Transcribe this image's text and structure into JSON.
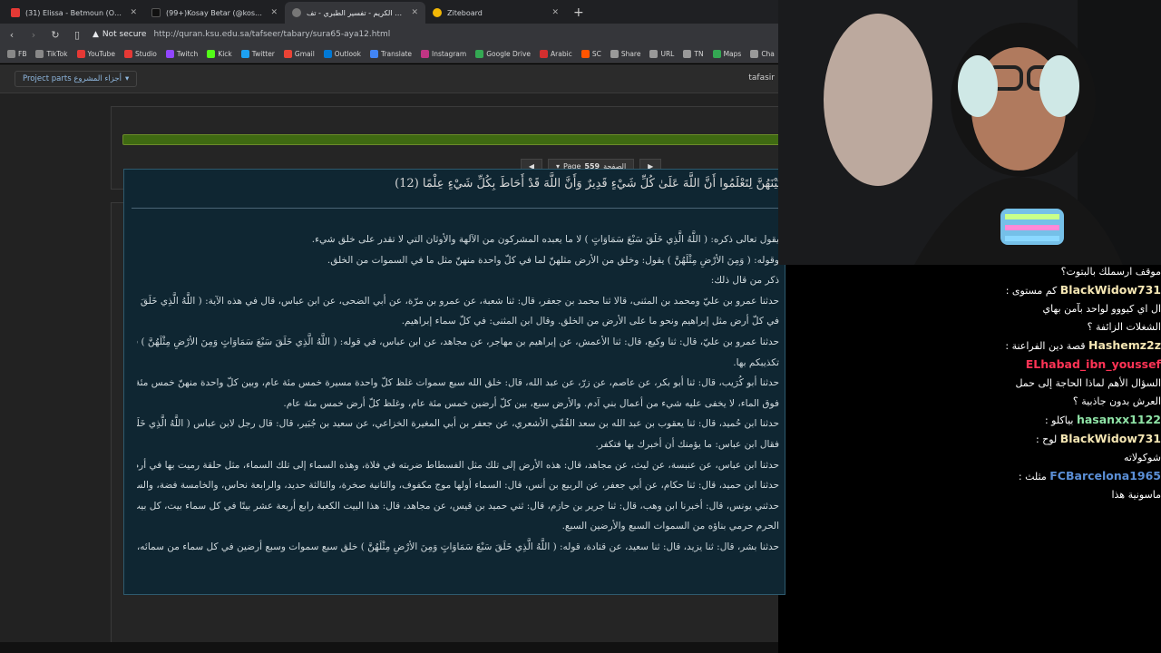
{
  "tabs": [
    {
      "title": "(31) Elissa - Betmoun (Official Clip) /",
      "color": "#e53935",
      "active": false
    },
    {
      "title": "(99+)Kosay Betar (@kosay.betar) | Ti",
      "color": "#111111",
      "active": false
    },
    {
      "title": "القرآن الكريم - تفسير الطبري - تف",
      "color": "#777777",
      "active": true
    },
    {
      "title": "Ziteboard",
      "color": "#f2b705",
      "active": false
    }
  ],
  "new_tab": "+",
  "address": {
    "warning": "Not secure",
    "url": "http://quran.ksu.edu.sa/tafseer/tabary/sura65-aya12.html"
  },
  "bookmarks": [
    {
      "label": "FB",
      "color": "#888888"
    },
    {
      "label": "TikTok",
      "color": "#888888"
    },
    {
      "label": "YouTube",
      "color": "#e53935"
    },
    {
      "label": "Studio",
      "color": "#e53935"
    },
    {
      "label": "Twitch",
      "color": "#9146ff"
    },
    {
      "label": "Kick",
      "color": "#53fc18"
    },
    {
      "label": "Twitter",
      "color": "#1da1f2"
    },
    {
      "label": "Gmail",
      "color": "#ea4335"
    },
    {
      "label": "Outlook",
      "color": "#0078d4"
    },
    {
      "label": "Translate",
      "color": "#4285f4"
    },
    {
      "label": "Instagram",
      "color": "#c13584"
    },
    {
      "label": "Google Drive",
      "color": "#34a853"
    },
    {
      "label": "Arabic",
      "color": "#d32f2f"
    },
    {
      "label": "SC",
      "color": "#ff5500"
    },
    {
      "label": "Share",
      "color": "#999999"
    },
    {
      "label": "URL",
      "color": "#999999"
    },
    {
      "label": "TN",
      "color": "#999999"
    },
    {
      "label": "Maps",
      "color": "#34a853"
    },
    {
      "label": "Cha",
      "color": "#999999"
    }
  ],
  "site": {
    "project_parts": "Project parts أجزاء المشروع",
    "tafsir_label": "tafasir"
  },
  "pager": {
    "page_label": "Page",
    "page_number": "559",
    "page_ar": "الصفحة"
  },
  "ayah": "بَيْنَهُنَّ لِتَعْلَمُوا أَنَّ اللَّهَ عَلَىٰ كُلِّ شَيْءٍ قَدِيرٌ وَأَنَّ اللَّهَ قَدْ أَحَاطَ بِكُلِّ شَيْءٍ عِلْمًا (12)",
  "tafsir_lines": [
    "يقول تعالى ذكره: ( اللَّهُ الَّذِي خَلَقَ سَبْعَ سَمَاوَاتٍ ) لا ما يعبده المشركون من الآلهة والأوثان التي لا تقدر على خلق شيء.",
    "وقوله: ( وَمِنَ الأرْضِ مِثْلَهُنَّ ) يقول: وخلق من الأرض مثلهنّ لما في كلّ واحدة منهنّ مثل ما في السموات من الخلق.",
    "ذكر من قال ذلك:",
    "حدثنا عمرو بن عليّ ومحمد بن المثنى، قالا ثنا محمد بن جعفر، قال: ثنا شعبة، عن عمرو بن مرّة، عن أبي الضحى، عن ابن عباس، قال في هذه الآية: ( اللَّهُ الَّذِي خَلَقَ سَبْعَ سَمَاوَاتٍ وَمِنَ الأرْضِ مِثْلَهُنَّ ) قال عمرو: قال:",
    "في كلّ أرض مثل إبراهيم ونحو ما على الأرض من الخلق. وقال ابن المثنى: في كلّ سماء إبراهيم.",
    "حدثنا عمرو بن عليّ، قال: ثنا وكيع، قال: ثنا الأعمش، عن إبراهيم بن مهاجر، عن مجاهد، عن ابن عباس، في قوله: ( اللَّهُ الَّذِي خَلَقَ سَبْعَ سَمَاوَاتٍ وَمِنَ الأرْضِ مِثْلَهُنَّ ) قال: لو حدثتكم بتفسيرها لكفرتم وكفركم",
    "تكذيبكم بها.",
    "حدثنا أبو كُرَيب، قال: ثنا أبو بكر، عن عاصم، عن زرّ، عن عبد الله، قال: خلق الله سبع سموات غلظ كلّ واحدة مسيرة خمس مئة عام، وبين كلّ واحدة منهنّ خمس مئة عام، وفوق السبع السموات الماء، والله جلّ ثناؤه",
    "فوق الماء، لا يخفى عليه شيء من أعمال بني آدم. والأرض سبع، بين كلّ أرضين خمس مئة عام، وغلظ كلّ أرض خمس مئة عام.",
    "حدثنا ابن حُميد، قال: ثنا يعقوب بن عبد الله بن سعد القُمِّي الأشعري، عن جعفر بن أبي المغيرة الخزاعي، عن سعيد بن جُبَير، قال: قال رجل لابن عباس ( اللَّهُ الَّذِي خَلَقَ سَبْعَ سَمَاوَاتٍ وَمِنَ الأرْضِ مِثْلَهُنَّ ) ... الآية،",
    "فقال ابن عباس: ما يؤمنك أن أخبرك بها فتكفر.",
    "حدثنا ابن عباس، عن عنبسة، عن ليث، عن مجاهد، قال: هذه الأرض إلى تلك مثل الفسطاط ضربته في فلاة، وهذه السماء إلى تلك السماء، مثل حلقة رميت بها في أرض فلاة.",
    "حدثنا ابن حميد، قال: ثنا حكام، عن أبي جعفر، عن الربيع بن أنس، قال: السماء أولها موج مكفوف، والثانية صخرة، والثالثة حديد، والرابعة نحاس، والخامسة فضة، والسادسة ذهب، والسابعة ياقوتة.",
    "حدثني يونس، قال: أخبرنا ابن وهب، قال: ثنا جرير بن حازم، قال: ثني حميد بن قيس، عن مجاهد، قال: هذا البيت الكعبة رابع أربعة عشر بيتًا في كل سماء بيت، كل بيت منها حذو صاحبه، لو وقع وقع عليه، وإن هذا",
    "الحرم حرمي بناؤه من السموات السبع والأرضين السبع.",
    "حدثنا بشر، قال: ثنا يزيد، قال: ثنا سعيد، عن قتادة، قوله: ( اللَّهُ الَّذِي خَلَقَ سَبْعَ سَمَاوَاتٍ وَمِنَ الأرْضِ مِثْلَهُنَّ ) خلق سبع سموات وسبع أرضين في كل سماء من سمائه، وأرض من أرضه، خلق من خلقه وأمر من أمره،"
  ],
  "chat": [
    {
      "user": "",
      "text": "موقف ارسملك بالبتوت؟",
      "color": "#ffffff"
    },
    {
      "user": "BlackWidow731",
      "text": "كم مستوى :",
      "color": "#f5e6b3"
    },
    {
      "user": "",
      "text": "ال اي كيووو لواحد بآمن بهاي",
      "color": "#ffffff"
    },
    {
      "user": "",
      "text": "الشغلات الزائفة ؟",
      "color": "#ffffff"
    },
    {
      "user": "Hashemz2z",
      "text": "قصة دين الفراعنة :",
      "color": "#f5e6b3"
    },
    {
      "user": "ELhabad_ibn_youssef",
      "text": "",
      "color": "#ff3355"
    },
    {
      "user": "",
      "text": "السؤال الأهم لماذا الحاجة إلى حمل",
      "color": "#ffffff"
    },
    {
      "user": "",
      "text": "العرش بدون جاذبية ؟",
      "color": "#ffffff"
    },
    {
      "user": "hasanxx1122",
      "text": "بياكلو :",
      "color": "#8fe3a6"
    },
    {
      "user": "BlackWidow731",
      "text": "لوح :",
      "color": "#f5e6b3"
    },
    {
      "user": "",
      "text": "شوكولاته",
      "color": "#ffffff"
    },
    {
      "user": "FCBarcelona1965",
      "text": "مثلث :",
      "color": "#5b8fd6"
    },
    {
      "user": "",
      "text": "ماسونية هذا",
      "color": "#ffffff"
    }
  ]
}
